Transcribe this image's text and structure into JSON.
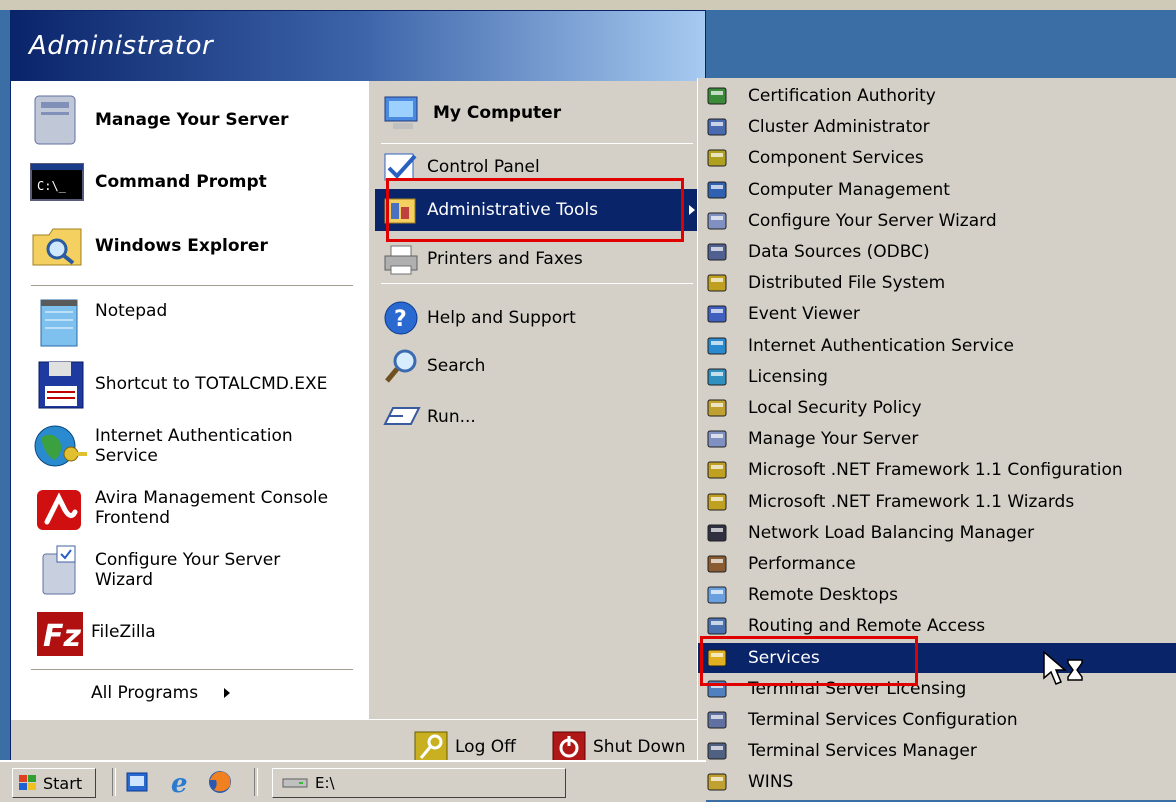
{
  "user": {
    "name": "Administrator"
  },
  "left_pinned": [
    {
      "label": "Manage Your Server",
      "icon": "server-icon"
    },
    {
      "label": "Command Prompt",
      "icon": "command-prompt-icon"
    },
    {
      "label": "Windows Explorer",
      "icon": "folder-search-icon"
    }
  ],
  "left_recent": [
    {
      "label": "Notepad",
      "icon": "notepad-icon"
    },
    {
      "label": "Shortcut to TOTALCMD.EXE",
      "icon": "floppy-icon"
    },
    {
      "label": "Internet Authentication Service",
      "icon": "globe-key-icon"
    },
    {
      "label": "Avira Management Console Frontend",
      "icon": "avira-icon"
    },
    {
      "label": "Configure Your Server Wizard",
      "icon": "server-wizard-icon"
    },
    {
      "label": "FileZilla",
      "icon": "filezilla-icon"
    }
  ],
  "all_programs": "All Programs",
  "right_items": {
    "my_computer": "My Computer",
    "control_panel": "Control Panel",
    "admin_tools": "Administrative Tools",
    "printers": "Printers and Faxes",
    "help": "Help and Support",
    "search": "Search",
    "run": "Run..."
  },
  "bottom": {
    "logoff": "Log Off",
    "shutdown": "Shut Down"
  },
  "admin_tools_submenu": [
    "Certification Authority",
    "Cluster Administrator",
    "Component Services",
    "Computer Management",
    "Configure Your Server Wizard",
    "Data Sources (ODBC)",
    "Distributed File System",
    "Event Viewer",
    "Internet Authentication Service",
    "Licensing",
    "Local Security Policy",
    "Manage Your Server",
    "Microsoft .NET Framework 1.1 Configuration",
    "Microsoft .NET Framework 1.1 Wizards",
    "Network Load Balancing Manager",
    "Performance",
    "Remote Desktops",
    "Routing and Remote Access",
    "Services",
    "Terminal Server Licensing",
    "Terminal Services Configuration",
    "Terminal Services Manager",
    "WINS"
  ],
  "highlighted_submenu_item": "Services",
  "taskbar": {
    "start": "Start",
    "window_title": "E:\\"
  },
  "colors": {
    "highlight": "#0a246a",
    "annotation": "#e00000",
    "menu_face": "#d4d0c8"
  }
}
